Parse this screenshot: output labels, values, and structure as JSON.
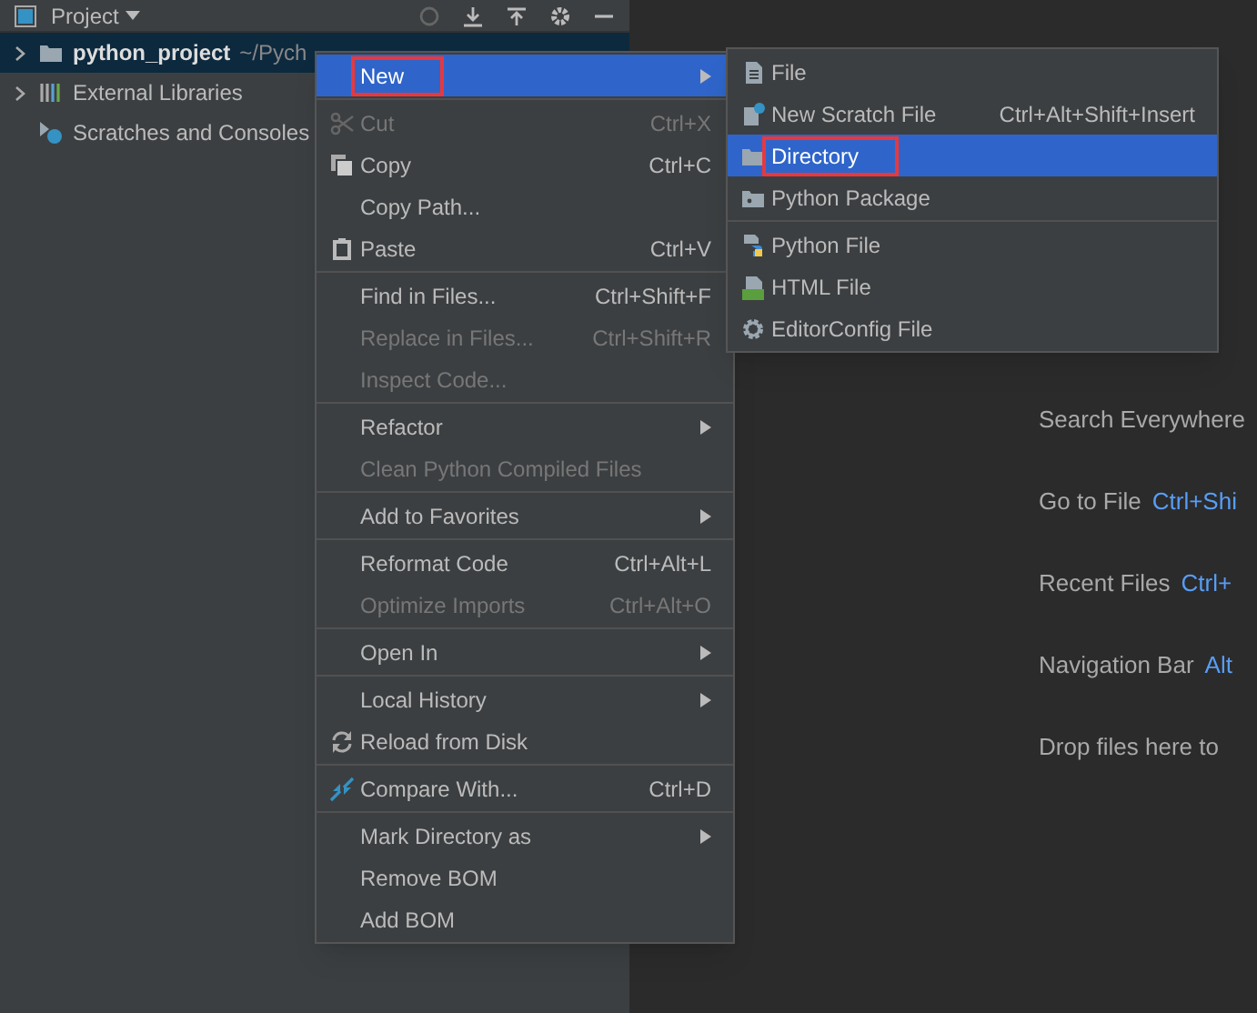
{
  "project_panel": {
    "title": "Project"
  },
  "tree": [
    {
      "name": "python_project",
      "path": "~/Pych",
      "selected": true,
      "expandable": true
    },
    {
      "name": "External Libraries",
      "selected": false,
      "expandable": true
    },
    {
      "name": "Scratches and Consoles",
      "selected": false,
      "expandable": false
    }
  ],
  "context_menu": {
    "groups": [
      [
        {
          "label": "New",
          "submenu": true,
          "disabled": false,
          "selected": true,
          "highlighted": true
        }
      ],
      [
        {
          "label": "Cut",
          "shortcut": "Ctrl+X",
          "disabled": true,
          "selected": false
        },
        {
          "label": "Copy",
          "shortcut": "Ctrl+C",
          "disabled": false,
          "selected": false
        },
        {
          "label": "Copy Path...",
          "disabled": false,
          "selected": false
        },
        {
          "label": "Paste",
          "shortcut": "Ctrl+V",
          "disabled": false,
          "selected": false
        }
      ],
      [
        {
          "label": "Find in Files...",
          "shortcut": "Ctrl+Shift+F",
          "disabled": false,
          "selected": false
        },
        {
          "label": "Replace in Files...",
          "shortcut": "Ctrl+Shift+R",
          "disabled": true,
          "selected": false
        },
        {
          "label": "Inspect Code...",
          "disabled": true,
          "selected": false
        }
      ],
      [
        {
          "label": "Refactor",
          "submenu": true,
          "disabled": false,
          "selected": false
        },
        {
          "label": "Clean Python Compiled Files",
          "disabled": true,
          "selected": false
        }
      ],
      [
        {
          "label": "Add to Favorites",
          "submenu": true,
          "disabled": false,
          "selected": false
        }
      ],
      [
        {
          "label": "Reformat Code",
          "shortcut": "Ctrl+Alt+L",
          "disabled": false,
          "selected": false
        },
        {
          "label": "Optimize Imports",
          "shortcut": "Ctrl+Alt+O",
          "disabled": true,
          "selected": false
        }
      ],
      [
        {
          "label": "Open In",
          "submenu": true,
          "disabled": false,
          "selected": false
        }
      ],
      [
        {
          "label": "Local History",
          "submenu": true,
          "disabled": false,
          "selected": false
        },
        {
          "label": "Reload from Disk",
          "disabled": false,
          "selected": false
        }
      ],
      [
        {
          "label": "Compare With...",
          "shortcut": "Ctrl+D",
          "disabled": false,
          "selected": false
        }
      ],
      [
        {
          "label": "Mark Directory as",
          "submenu": true,
          "disabled": false,
          "selected": false
        },
        {
          "label": "Remove BOM",
          "disabled": false,
          "selected": false
        },
        {
          "label": "Add BOM",
          "disabled": false,
          "selected": false
        }
      ]
    ]
  },
  "new_submenu": {
    "groups": [
      [
        {
          "label": "File",
          "selected": false
        },
        {
          "label": "New Scratch File",
          "shortcut": "Ctrl+Alt+Shift+Insert",
          "selected": false
        },
        {
          "label": "Directory",
          "selected": true,
          "highlighted": true
        },
        {
          "label": "Python Package",
          "selected": false
        }
      ],
      [
        {
          "label": "Python File",
          "selected": false
        },
        {
          "label": "HTML File",
          "selected": false
        },
        {
          "label": "EditorConfig File",
          "selected": false
        }
      ]
    ]
  },
  "editor_hints": [
    {
      "label": "Search Everywhere"
    },
    {
      "label": "Go to File",
      "shortcut": "Ctrl+Shi"
    },
    {
      "label": "Recent Files",
      "shortcut": "Ctrl+"
    },
    {
      "label": "Navigation Bar",
      "shortcut": "Alt"
    },
    {
      "label": "Drop files here to"
    }
  ]
}
